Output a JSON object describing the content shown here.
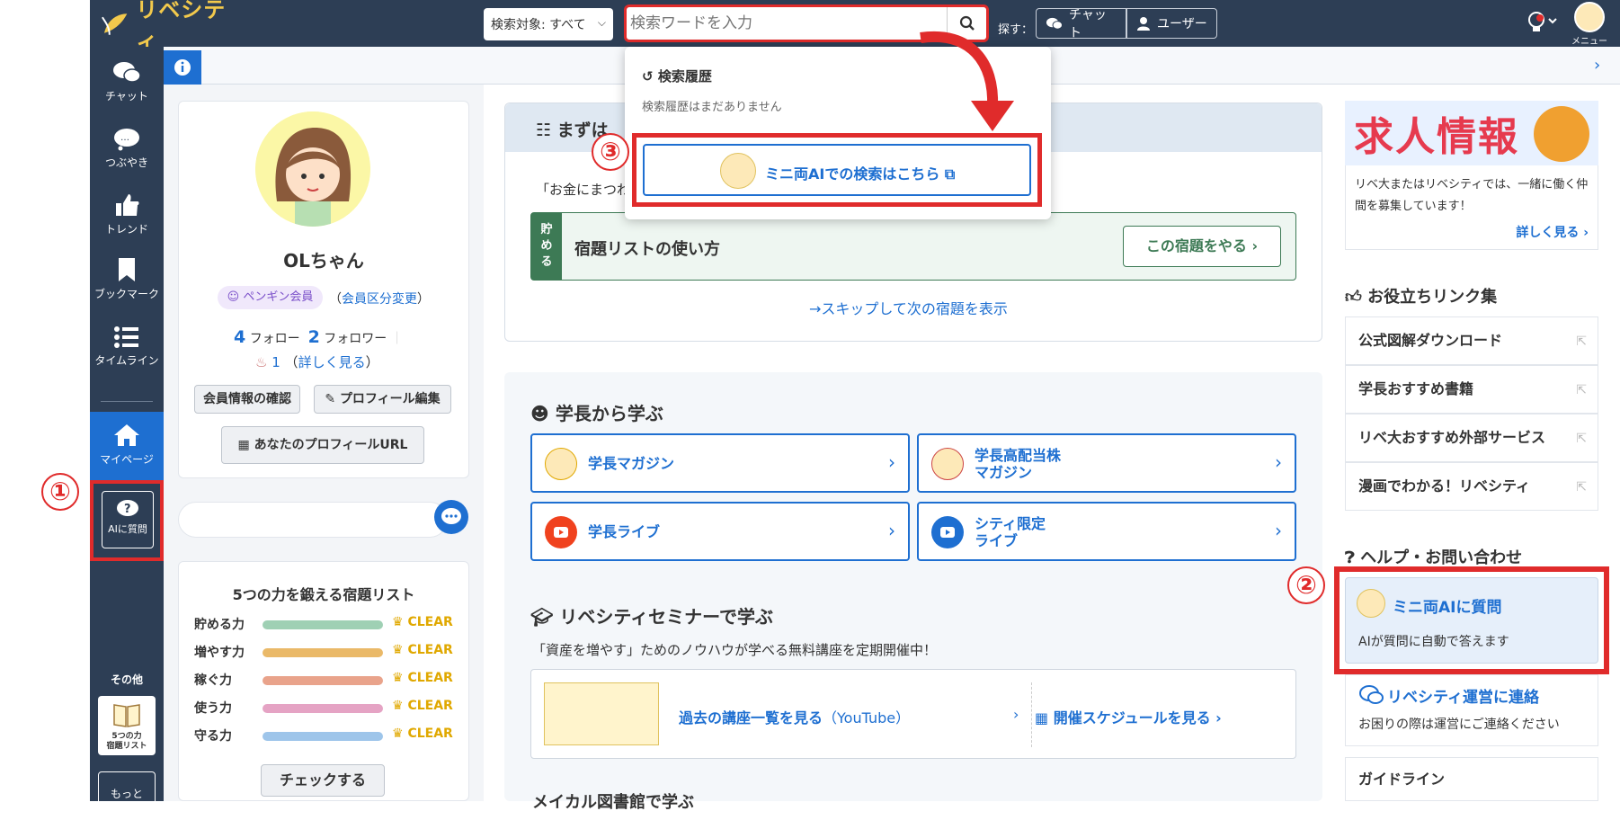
{
  "header": {
    "logo_text": "リベシティ",
    "search_scope": "検索対象: すべて",
    "search_placeholder": "検索ワードを入力",
    "find_label": "探す：",
    "find_chat": "チャット",
    "find_user": "ユーザー",
    "menu_label": "メニュー"
  },
  "sidebar": {
    "items": [
      {
        "label": "チャット"
      },
      {
        "label": "つぶやき"
      },
      {
        "label": "トレンド"
      },
      {
        "label": "ブックマーク"
      },
      {
        "label": "タイムライン"
      },
      {
        "label": "マイページ"
      }
    ],
    "ai_ask": "AIに質問",
    "other_label": "その他",
    "homework_tile": "5つの力\n宿題リスト",
    "more": "もっと\n見る ▶"
  },
  "annotations": {
    "n1": "①",
    "n2": "②",
    "n3": "③"
  },
  "profile": {
    "name": "OLちゃん",
    "badge": "ペンギン会員",
    "change_class": "会員区分変更",
    "follow_count": "4",
    "follow_label": "フォロー",
    "follower_count": "2",
    "follower_label": "フォロワー",
    "likes": "1",
    "details": "詳しく見る",
    "check_info": "会員情報の確認",
    "edit_profile": "プロフィール編集",
    "profile_url": "あなたのプロフィールURL"
  },
  "homework": {
    "title": "5つの力を鍛える宿題リスト",
    "rows": [
      {
        "label": "貯める力",
        "status": "CLEAR",
        "color": "#9fd0b4"
      },
      {
        "label": "増やす力",
        "status": "CLEAR",
        "color": "#eab968"
      },
      {
        "label": "稼ぐ力",
        "status": "CLEAR",
        "color": "#e9a38b"
      },
      {
        "label": "使う力",
        "status": "CLEAR",
        "color": "#e5a3c4"
      },
      {
        "label": "守る力",
        "status": "CLEAR",
        "color": "#9ec5ea"
      }
    ],
    "check_button": "チェックする"
  },
  "search_dropdown": {
    "history_title": "検索履歴",
    "history_empty": "検索履歴はまだありません",
    "mini_ai_search": "ミニ両AIでの検索はこちら"
  },
  "first_step": {
    "title": "まずは",
    "text_left": "「お金にまつわ",
    "text_right": "!",
    "task_tag": "貯める",
    "task_name": "宿題リストの使い方",
    "task_button": "この宿題をやる",
    "skip_link": "スキップして次の宿題を表示"
  },
  "learn": {
    "title": "学長から学ぶ",
    "links": [
      {
        "label": "学長マガジン"
      },
      {
        "label": "学長高配当株\nマガジン"
      },
      {
        "label": "学長ライブ"
      },
      {
        "label": "シティ限定\nライブ"
      }
    ],
    "seminar_title": "リベシティセミナーで学ぶ",
    "seminar_text": "「資産を増やす」ためのノウハウが学べる無料講座を定期開催中！",
    "past_link": "過去の講座一覧を見る",
    "past_link_sub": "（YouTube）",
    "schedule_link": "開催スケジュールを見る",
    "library_title": "メイカル図書館で学ぶ"
  },
  "right": {
    "job_banner": "求人情報",
    "job_desc": "リベ大またはリベシティでは、一緒に働く仲間を募集しています！",
    "job_more": "詳しく見る",
    "links_title": "お役立ちリンク集",
    "links": [
      {
        "label": "公式図解ダウンロード"
      },
      {
        "label": "学長おすすめ書籍"
      },
      {
        "label": "リベ大おすすめ外部サービス"
      },
      {
        "label": "漫画でわかる！リベシティ"
      }
    ],
    "help_title": "ヘルプ・お問い合わせ",
    "mini_ask_title": "ミニ両AIに質問",
    "mini_ask_desc": "AIが質問に自動で答えます",
    "contact_title": "リベシティ運営に連絡",
    "contact_desc": "お困りの際は運営にご連絡ください",
    "guideline": "ガイドライン"
  },
  "colors": {
    "navy": "#2d3e55",
    "blue": "#1e6fd1",
    "red_highlight": "#e02b2b",
    "green": "#3d7a55"
  }
}
